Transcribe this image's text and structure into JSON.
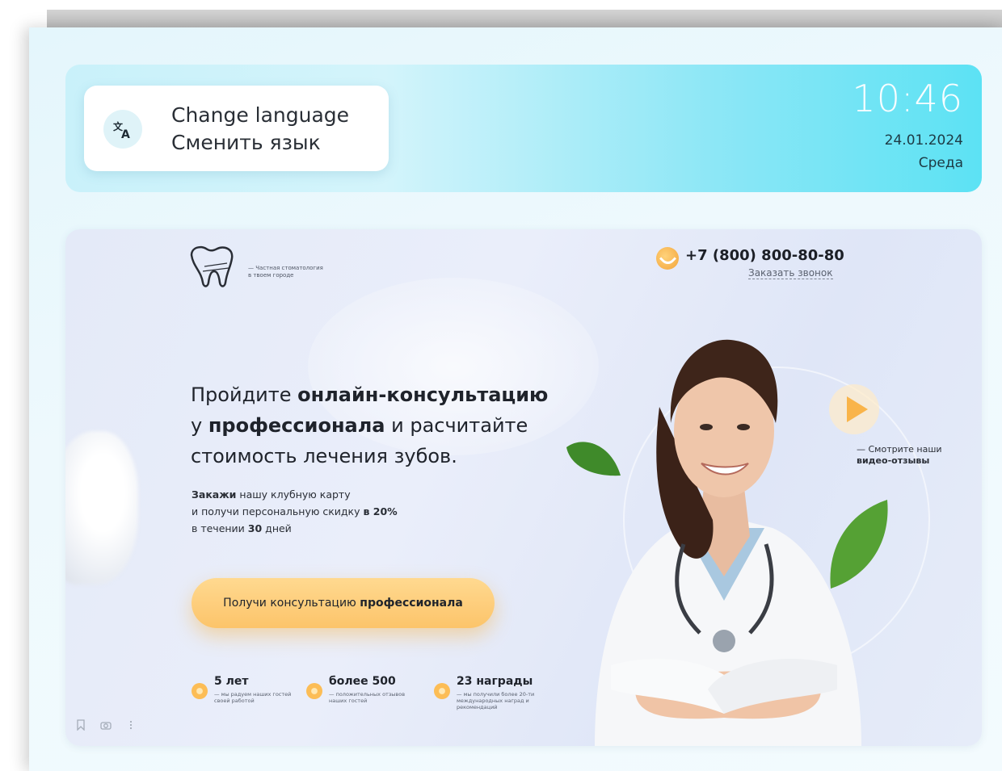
{
  "header": {
    "language": {
      "line1": "Change language",
      "line2": "Сменить язык",
      "icon": "translate-icon"
    },
    "clock": {
      "time": "10:46",
      "date": "24.01.2024",
      "weekday": "Среда"
    }
  },
  "banner": {
    "logo_caption_line1": "— Частная стоматология",
    "logo_caption_line2": "в твоем городе",
    "phone": "+7 (800) 800-80-80",
    "callback": "Заказать звонок",
    "headline": {
      "p1": "Пройдите ",
      "b1": "онлайн-консультацию",
      "p2": "у ",
      "b2": "профессионала",
      "p3": " и расчитайте",
      "p4": "стоимость лечения зубов."
    },
    "promo": {
      "b1": "Закажи",
      "p1": " нашу клубную карту",
      "p2": "и получи персональную скидку ",
      "b2": "в 20%",
      "p3": "в течении ",
      "b3": "30",
      "p4": " дней"
    },
    "cta": {
      "prefix": "Получи консультацию ",
      "bold": "профессионала"
    },
    "stats": [
      {
        "title": "5 лет",
        "desc": "— мы радуем наших гостей своей работой"
      },
      {
        "title": "более 500",
        "desc": "— положительных отзывов наших гостей"
      },
      {
        "title": "23 награды",
        "desc": "— мы получили более 20-ти международных наград и рекомендаций"
      }
    ],
    "video": {
      "line1": "— Смотрите наши",
      "line2": "видео-отзывы"
    }
  },
  "colors": {
    "header_gradient_end": "#5ce2f4",
    "accent_orange": "#fcc46a",
    "text_dark": "#1f232b"
  }
}
